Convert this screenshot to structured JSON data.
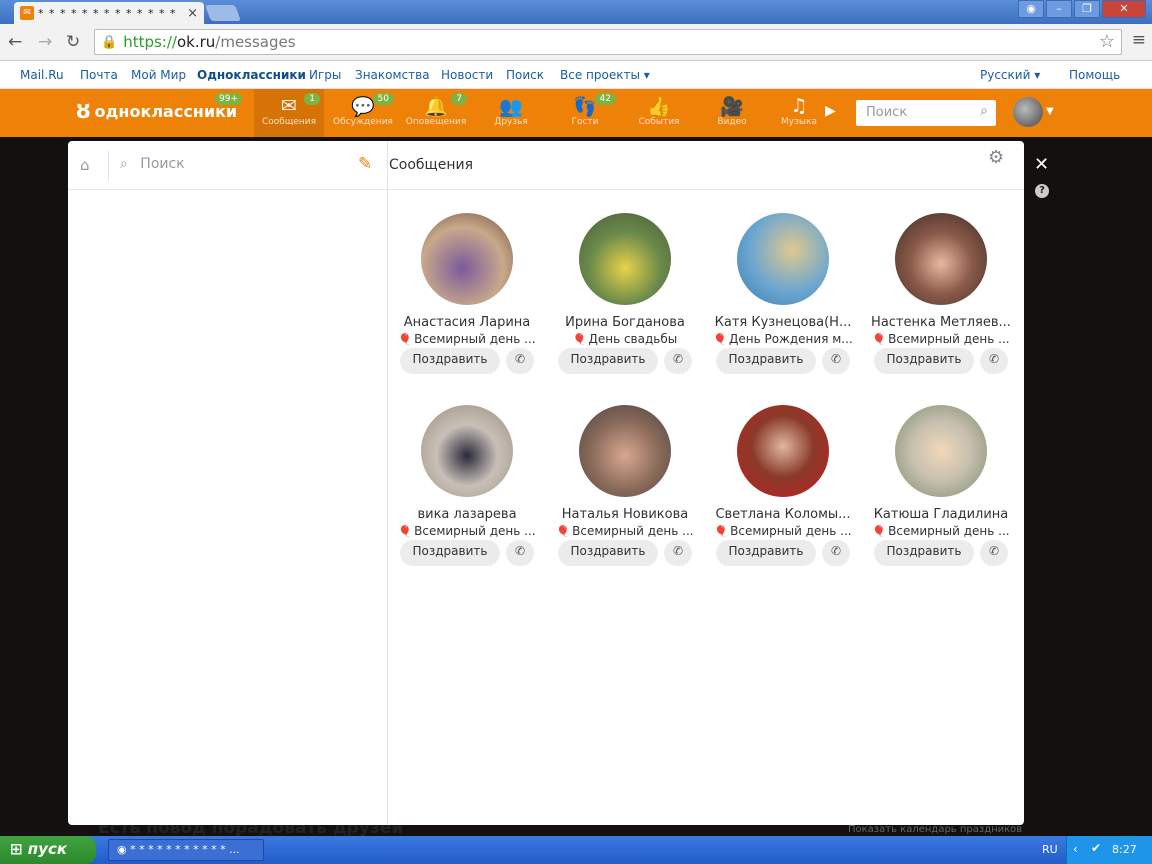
{
  "browser": {
    "tab_title": "* * * * * * * * * * * * *",
    "tab_close": "×",
    "url_scheme": "https://",
    "url_host": "ok.ru",
    "url_path": "/messages"
  },
  "portal": {
    "links": [
      "Mail.Ru",
      "Почта",
      "Мой Мир",
      "Одноклассники",
      "Игры",
      "Знакомства",
      "Новости",
      "Поиск",
      "Все проекты ▾"
    ],
    "language": "Русский ▾",
    "help": "Помощь"
  },
  "okbar": {
    "logo_text": "одноклассники",
    "logo_badge": "99+",
    "nav": [
      {
        "label": "Сообщения",
        "badge": "1",
        "icon": "envelope-icon"
      },
      {
        "label": "Обсуждения",
        "badge": "50",
        "icon": "chat-icon"
      },
      {
        "label": "Оповещения",
        "badge": "7",
        "icon": "bell-icon"
      },
      {
        "label": "Друзья",
        "badge": "",
        "icon": "friends-icon"
      },
      {
        "label": "Гости",
        "badge": "42",
        "icon": "footprints-icon"
      },
      {
        "label": "События",
        "badge": "",
        "icon": "events-icon"
      },
      {
        "label": "Видео",
        "badge": "",
        "icon": "video-icon"
      },
      {
        "label": "Музыка",
        "badge": "",
        "icon": "music-icon"
      }
    ],
    "search_placeholder": "Поиск"
  },
  "modal": {
    "search_placeholder": "Поиск",
    "title": "Сообщения",
    "congratulate_label": "Поздравить",
    "cards": [
      {
        "name": "Анастасия Ларина",
        "event": "Всемирный день ..."
      },
      {
        "name": "Ирина Богданова",
        "event": "День свадьбы"
      },
      {
        "name": "Катя Кузнецова(Н...",
        "event": "День Рождения м..."
      },
      {
        "name": "Настенка Метляев...",
        "event": "Всемирный день ..."
      },
      {
        "name": "вика лазарева",
        "event": "Всемирный день ..."
      },
      {
        "name": "Наталья Новикова",
        "event": "Всемирный день ..."
      },
      {
        "name": "Светлана Коломы...",
        "event": "Всемирный день ..."
      },
      {
        "name": "Катюша Гладилина",
        "event": "Всемирный день ..."
      }
    ]
  },
  "background": {
    "headline": "Есть повод порадовать друзей",
    "calendar_link": "Показать календарь праздников"
  },
  "taskbar": {
    "start": "пуск",
    "task": "* * * * * * * * * * * ...",
    "lang": "RU",
    "clock": "8:27"
  }
}
